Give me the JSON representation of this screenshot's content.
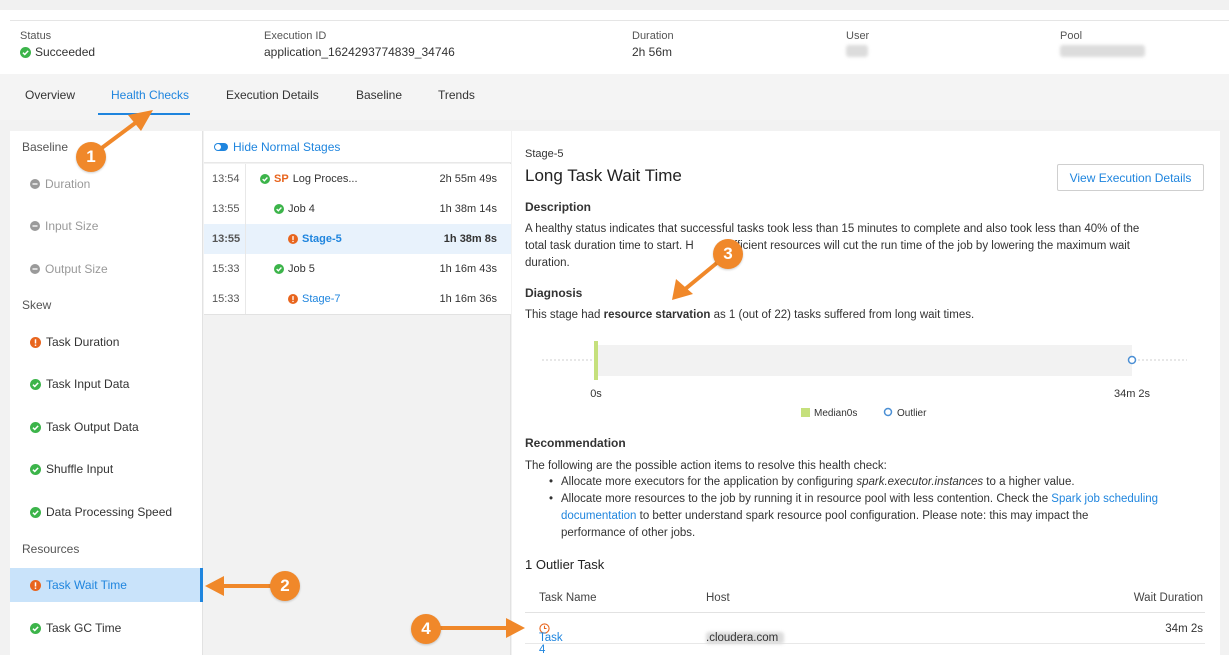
{
  "summary": {
    "status_label": "Status",
    "status_value": "Succeeded",
    "exec_label": "Execution ID",
    "exec_value": "application_1624293774839_34746",
    "duration_label": "Duration",
    "duration_value": "2h 56m",
    "user_label": "User",
    "pool_label": "Pool"
  },
  "tabs": [
    "Overview",
    "Health Checks",
    "Execution Details",
    "Baseline",
    "Trends"
  ],
  "left": {
    "sections": [
      "Baseline",
      "Skew",
      "Resources"
    ],
    "baseline_items": [
      "Duration",
      "Input Size",
      "Output Size"
    ],
    "skew_items": [
      "Task Duration",
      "Task Input Data",
      "Task Output Data",
      "Shuffle Input",
      "Data Processing Speed"
    ],
    "resource_items": [
      "Task Wait Time",
      "Task GC Time"
    ]
  },
  "mid": {
    "toggle_label": "Hide Normal Stages",
    "rows": [
      {
        "time": "13:54",
        "badge": "SP",
        "name": "Log Proces...",
        "dur": "2h 55m 49s"
      },
      {
        "time": "13:55",
        "name": "Job 4",
        "dur": "1h 38m 14s"
      },
      {
        "time": "13:55",
        "name": "Stage-5",
        "dur": "1h 38m 8s"
      },
      {
        "time": "15:33",
        "name": "Job 5",
        "dur": "1h 16m 43s"
      },
      {
        "time": "15:33",
        "name": "Stage-7",
        "dur": "1h 16m 36s"
      }
    ]
  },
  "detail": {
    "stage": "Stage-5",
    "title": "Long Task Wait Time",
    "button": "View Execution Details",
    "desc_h": "Description",
    "desc_1": "A healthy status indicates that successful tasks took less than 15 minutes to complete and also took less than 40% of the",
    "desc_2a": "total task duration time to start. H",
    "desc_2b": "sufficient resources will cut the run time of the job by lowering the maximum wait",
    "desc_3": "duration.",
    "diag_h": "Diagnosis",
    "diag_pre": "This stage had ",
    "diag_bold": "resource starvation",
    "diag_post": " as 1 (out of 22) tasks suffered from long wait times.",
    "rec_h": "Recommendation",
    "rec_intro": "The following are the possible action items to resolve this health check:",
    "rec1_pre": "Allocate more executors for the application by configuring ",
    "rec1_em": "spark.executor.instances",
    "rec1_post": " to a higher value.",
    "rec2_pre": "Allocate more resources to the job by running it in resource pool with less contention. Check the ",
    "rec2_link1": "Spark job scheduling",
    "rec2_link2": "documentation",
    "rec2_mid": " to better understand spark resource pool configuration. Please note: this may impact the",
    "rec2_post": "performance of other jobs.",
    "outlier_h": "1 Outlier Task",
    "col_task": "Task Name",
    "col_host": "Host",
    "col_wait": "Wait Duration",
    "task_name": "Task 4",
    "task_host": ".cloudera.com",
    "task_wait": "34m 2s"
  },
  "chart_data": {
    "type": "scatter",
    "x_start_label": "0s",
    "x_end_label": "34m 2s",
    "median": 0,
    "outlier": 2042,
    "xlim": [
      0,
      2042
    ],
    "legend": [
      "Median0s",
      "Outlier"
    ],
    "colors": {
      "median": "#c5e07c",
      "outlier": "#4b8fd4"
    }
  },
  "callouts": [
    "1",
    "2",
    "3",
    "4"
  ],
  "colors": {
    "accent": "#1f85de",
    "success": "#3cb44a",
    "error": "#e8651e",
    "callout": "#f0882a"
  }
}
